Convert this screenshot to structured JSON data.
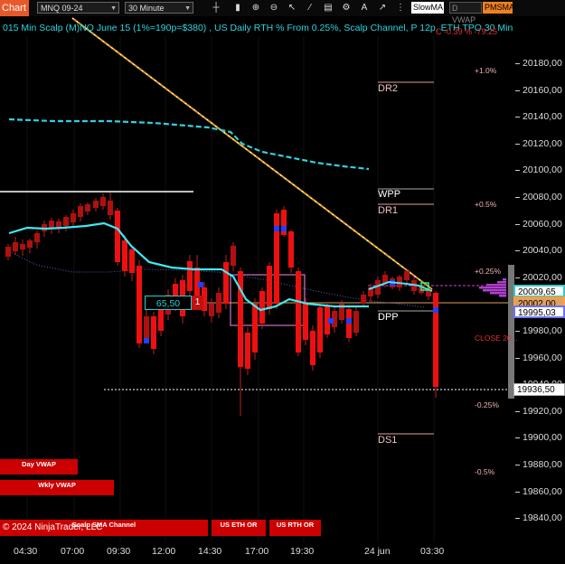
{
  "toolbar": {
    "tab_label": "Chart",
    "instrument": "MNQ 09-24",
    "timeframe": "30 Minute",
    "icons": [
      "crosshair-icon",
      "bar-style-icon",
      "zoom-icon",
      "zoom-out-icon",
      "pointer-icon",
      "draw-line-icon",
      "properties-icon",
      "gear-icon",
      "text-icon",
      "arrow-icon",
      "spacer-icon"
    ],
    "indicator_buttons": [
      {
        "label": "SlowMA",
        "color": "#dddddd",
        "bg": "#ffffff",
        "fg": "#000000"
      },
      {
        "label": "D VWAP",
        "color": "#777777",
        "bg": "#1a1a1a",
        "fg": "#888888"
      },
      {
        "label": "PMSMA",
        "color": "#e08030",
        "bg": "#f08020",
        "fg": "#000000"
      }
    ]
  },
  "header": {
    "title": "015 Min Scalp (M)NQ June 15 (1%=190p=$380) , US Daily RTH % From 0.25%, Scalp Channel, P 12p, ETH TPO 30 Min",
    "red_overlay": "C -0.39 % -79.25"
  },
  "y_axis": {
    "labels": [
      "20180,00",
      "20160,00",
      "20140,00",
      "20120,00",
      "20100,00",
      "20080,00",
      "20060,00",
      "20040,00",
      "20020,00",
      "20000,00",
      "19980,00",
      "19960,00",
      "19940,00",
      "19920,00",
      "19900,00",
      "19880,00",
      "19860,00",
      "19840,00"
    ],
    "flags": [
      {
        "label": "20009,65",
        "bg": "#ffffff",
        "fg": "#000000",
        "border": "#2ecbd0"
      },
      {
        "label": "20002,00",
        "bg": "#e0a060",
        "fg": "#000000",
        "border": "#ffa040"
      },
      {
        "label": "19995,03",
        "bg": "#ffffff",
        "fg": "#000000",
        "border": "#7070ff"
      },
      {
        "label": "19936,50",
        "bg": "#ffffff",
        "fg": "#000000",
        "border": "#aaaaaa"
      }
    ]
  },
  "x_axis": {
    "labels": [
      "04:30",
      "07:00",
      "09:30",
      "12:00",
      "14:30",
      "17:00",
      "19:30",
      "24 jun",
      "03:30"
    ]
  },
  "percent_levels": [
    "+1.0%",
    "+0.5%",
    "+0.25%",
    "-0.25%",
    "-0.5%"
  ],
  "pivots": {
    "dr2": "DR2",
    "wpp": "WPP",
    "dr1": "DR1",
    "dpp": "DPP",
    "ds1": "DS1"
  },
  "close_label": "CLOSE 20...",
  "trade_box": {
    "price": "65,50",
    "qty": "1"
  },
  "panels": {
    "day_vwap": "Day VWAP",
    "wkly_vwap": "Wkly VWAP",
    "scalp_sma": "Scalp SMA Channel",
    "us_eth_or": "US ETH OR",
    "us_rth_or": "US RTH OR"
  },
  "copyright": "© 2024 NinjaTrader, LLC",
  "colors": {
    "up": "#e01010",
    "down": "#c00000",
    "sma": "#40e8f0",
    "vwap": "#28c8d8",
    "trend": "#e0a020",
    "profile": "#b040d0"
  }
}
